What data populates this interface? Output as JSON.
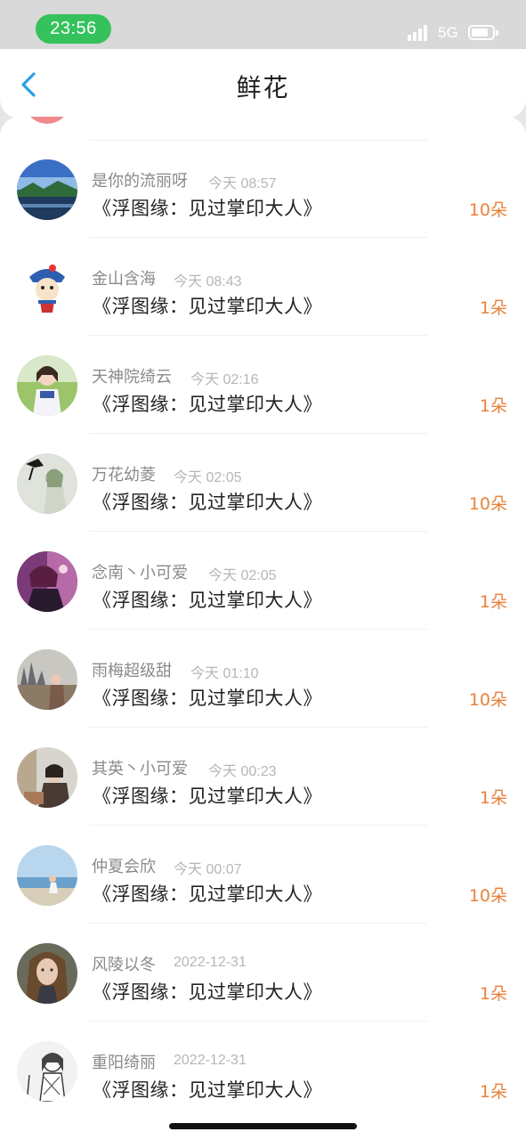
{
  "status_bar": {
    "time": "23:56",
    "network": "5G",
    "time_pill_color": "#35c25c"
  },
  "header": {
    "title": "鲜花",
    "back_icon": "chevron-left-icon",
    "accent": "#2aa0e6"
  },
  "list": {
    "items": [
      {
        "name": "是你的流丽呀",
        "time": "今天 08:57",
        "book": "《浮图缘：见过掌印大人》",
        "count": "10朵",
        "avatar": "landscape-lake"
      },
      {
        "name": "金山含海",
        "time": "今天 08:43",
        "book": "《浮图缘：见过掌印大人》",
        "count": "1朵",
        "avatar": "cartoon-character"
      },
      {
        "name": "天神院绮云",
        "time": "今天 02:16",
        "book": "《浮图缘：见过掌印大人》",
        "count": "1朵",
        "avatar": "girl-portrait"
      },
      {
        "name": "万花幼菱",
        "time": "今天 02:05",
        "book": "《浮图缘：见过掌印大人》",
        "count": "10朵",
        "avatar": "sketch-crow"
      },
      {
        "name": "念南丶小可爱",
        "time": "今天 02:05",
        "book": "《浮图缘：见过掌印大人》",
        "count": "1朵",
        "avatar": "anime-purple"
      },
      {
        "name": "雨梅超级甜",
        "time": "今天 01:10",
        "book": "《浮图缘：见过掌印大人》",
        "count": "10朵",
        "avatar": "castle-girl"
      },
      {
        "name": "其英丶小可爱",
        "time": "今天 00:23",
        "book": "《浮图缘：见过掌印大人》",
        "count": "1朵",
        "avatar": "room-photo"
      },
      {
        "name": "仲夏会欣",
        "time": "今天 00:07",
        "book": "《浮图缘：见过掌印大人》",
        "count": "10朵",
        "avatar": "seaside"
      },
      {
        "name": "风陵以冬",
        "time": "2022-12-31",
        "book": "《浮图缘：见过掌印大人》",
        "count": "1朵",
        "avatar": "woman-portrait"
      },
      {
        "name": "重阳绮丽",
        "time": "2022-12-31",
        "book": "《浮图缘：见过掌印大人》",
        "count": "1朵",
        "avatar": "sketch-girl"
      }
    ]
  },
  "colors": {
    "count": "#e8823a",
    "name": "#8a8a8a",
    "time": "#b6b6b6"
  }
}
